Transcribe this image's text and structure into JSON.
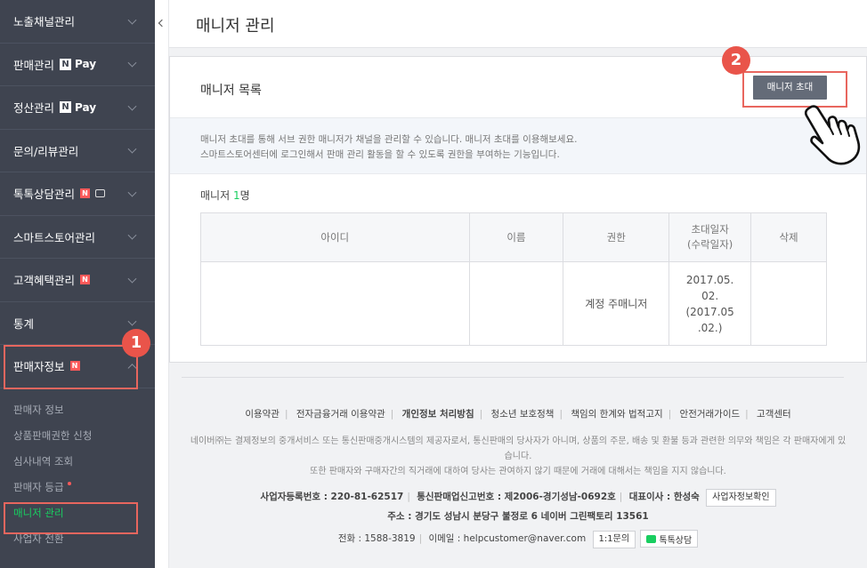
{
  "sidebar": {
    "menu": [
      {
        "label": "노출채널관리"
      },
      {
        "label": "판매관리",
        "npay": "Pay"
      },
      {
        "label": "정산관리",
        "npay": "Pay"
      },
      {
        "label": "문의/리뷰관리"
      },
      {
        "label": "톡톡상담관리",
        "badge": "N"
      },
      {
        "label": "스마트스토어관리"
      },
      {
        "label": "고객혜택관리",
        "badge": "N"
      },
      {
        "label": "통계"
      },
      {
        "label": "판매자정보",
        "badge": "N"
      }
    ],
    "npay_letter": "N",
    "submenu": [
      {
        "label": "판매자 정보"
      },
      {
        "label": "상품판매권한 신청"
      },
      {
        "label": "심사내역 조회"
      },
      {
        "label": "판매자 등급"
      },
      {
        "label": "매니저 관리"
      },
      {
        "label": "사업자 전환"
      }
    ]
  },
  "steps": {
    "one": "1",
    "two": "2"
  },
  "header": {
    "title": "매니저 관리"
  },
  "card": {
    "title": "매니저 목록",
    "invite_button": "매니저 초대",
    "info_line1": "매니저 초대를 통해 서브 권한 매니저가 채널을 관리할 수 있습니다. 매니저 초대를 이용해보세요.",
    "info_line2": "스마트스토어센터에 로그인해서 판매 관리 활동을 할 수 있도록 권한을 부여하는 기능입니다.",
    "count_prefix": "매니저 ",
    "count_num": "1",
    "count_suffix": "명"
  },
  "table": {
    "headers": {
      "id": "아이디",
      "name": "이름",
      "role": "권한",
      "date_line1": "초대일자",
      "date_line2": "(수락일자)",
      "delete": "삭제"
    },
    "row": {
      "id": "",
      "name": "",
      "role": "계정 주매니저",
      "date_line1": "2017.05.",
      "date_line2": "02.",
      "date_line3": "(2017.05",
      "date_line4": ".02.)",
      "delete": ""
    }
  },
  "footer": {
    "links": [
      "이용약관",
      "전자금융거래 이용약관",
      "개인정보 처리방침",
      "청소년 보호정책",
      "책임의 한계와 법적고지",
      "안전거래가이드",
      "고객센터"
    ],
    "note1": "네이버㈜는 결제정보의 중개서비스 또는 통신판매중개시스템의 제공자로서, 통신판매의 당사자가 아니며, 상품의 주문, 배송 및 환불 등과 관련한 의무와 책임은 각 판매자에게 있습니다.",
    "note2": "또한 판매자와 구매자간의 직거래에 대하여 당사는 관여하지 않기 때문에 거래에 대해서는 책임을 지지 않습니다.",
    "biz_reg": "사업자등록번호 : 220-81-62517",
    "mail_order": "통신판매업신고번호 : 제2006-경기성남-0692호",
    "ceo": "대표이사 : 한성숙",
    "biz_check_button": "사업자정보확인",
    "address": "주소 : 경기도 성남시 분당구 불정로 6 네이버 그린팩토리 13561",
    "phone": "전화 : 1588-3819",
    "email": "이메일 : helpcustomer@naver.com",
    "inquiry_button": "1:1문의",
    "talk_button": "톡톡상담"
  },
  "colors": {
    "sidebar_bg": "#3f4450",
    "accent_green": "#19ce60",
    "highlight_red": "#e8665e"
  }
}
